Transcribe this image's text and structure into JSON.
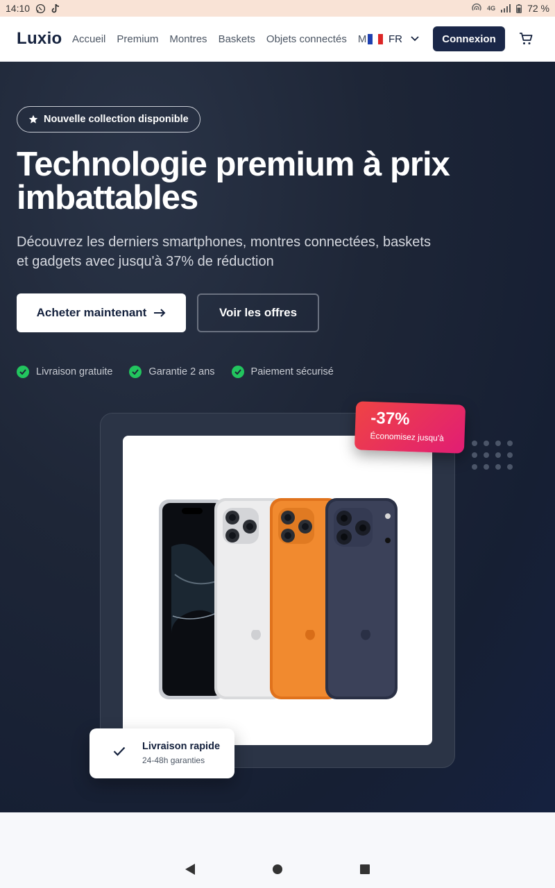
{
  "status": {
    "time": "14:10",
    "network": "4G",
    "battery": "72 %",
    "left_icons": [
      "whatsapp-icon",
      "tiktok-icon"
    ],
    "right_icons": [
      "hotspot-icon",
      "signal-icon",
      "battery-icon"
    ]
  },
  "header": {
    "logo": "Luxio",
    "links": [
      "Accueil",
      "Premium",
      "Montres",
      "Baskets",
      "Objets connectés",
      "Montres"
    ],
    "language": "FR",
    "login": "Connexion",
    "cart_icon": "cart-icon"
  },
  "hero": {
    "badge": "Nouvelle collection disponible",
    "title": "Technologie premium à prix imbattables",
    "subtitle": "Découvrez les derniers smartphones, montres connectées, baskets et gadgets avec jusqu'à 37% de réduction",
    "cta_primary": "Acheter maintenant",
    "cta_secondary": "Voir les offres",
    "features": [
      "Livraison gratuite",
      "Garantie 2 ans",
      "Paiement sécurisé"
    ],
    "discount": {
      "value": "-37%",
      "label": "Économisez jusqu'à"
    },
    "delivery": {
      "title": "Livraison rapide",
      "subtitle": "24-48h garanties"
    }
  },
  "colors": {
    "navy": "#1a2748",
    "accent_green": "#22c55e",
    "badge_red": "#ef4444",
    "badge_pink": "#e11d74"
  }
}
